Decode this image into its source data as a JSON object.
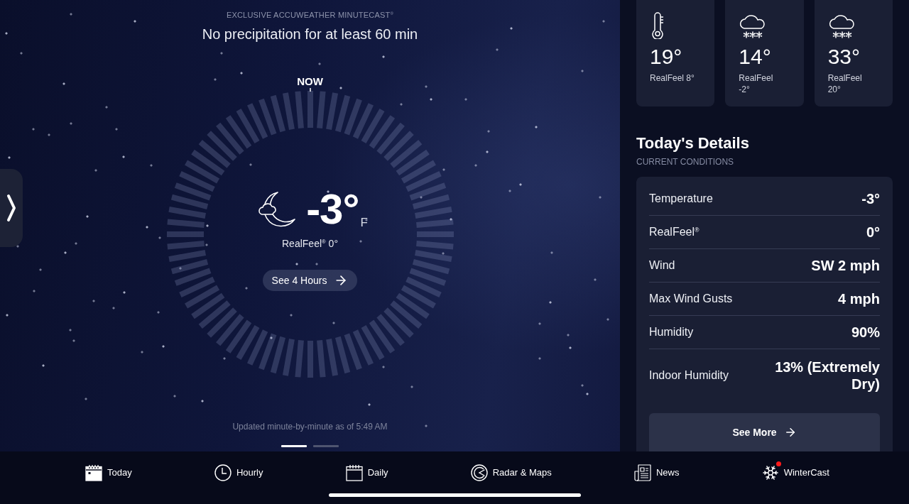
{
  "minutecast": {
    "label": "EXCLUSIVE ACCUWEATHER MINUTECAST$^{®}$",
    "headline": "No precipitation for at least 60 min",
    "now_label": "NOW",
    "temperature": "-3°",
    "unit": "F",
    "realfeel": "RealFeel$^{®}$ 0°",
    "button": "See 4 Hours",
    "updated": "Updated minute-by-minute as of 5:49 AM",
    "pages": [
      {
        "selected": true
      },
      {
        "selected": false
      }
    ]
  },
  "forecast_cards": [
    {
      "kind": "thermometer",
      "temperature": "19°",
      "realfeel": "RealFeel 8°"
    },
    {
      "kind": "snow",
      "temperature": "14°",
      "realfeel": "RealFeel -2°"
    },
    {
      "kind": "snow",
      "temperature": "33°",
      "realfeel": "RealFeel 20°"
    }
  ],
  "details": {
    "title": "Today's Details",
    "subtitle": "CURRENT CONDITIONS",
    "rows": [
      {
        "label": "Temperature",
        "value": "-3°"
      },
      {
        "label": "RealFeel$^{®}$",
        "value": "0°"
      },
      {
        "label": "Wind",
        "value": "SW 2 mph"
      },
      {
        "label": "Max Wind Gusts",
        "value": "4 mph"
      },
      {
        "label": "Humidity",
        "value": "90%"
      },
      {
        "label": "Indoor Humidity",
        "value": "13% (Extremely Dry)"
      }
    ],
    "button": "See More"
  },
  "tabs": [
    {
      "kind": "calendar",
      "label": "Today",
      "selected": true,
      "alert": false
    },
    {
      "kind": "clock",
      "label": "Hourly",
      "selected": false,
      "alert": false
    },
    {
      "kind": "calendar",
      "label": "Daily",
      "selected": false,
      "alert": false
    },
    {
      "kind": "radar",
      "label": "Radar & Maps",
      "selected": false,
      "alert": false
    },
    {
      "kind": "news",
      "label": "News",
      "selected": false,
      "alert": false
    },
    {
      "kind": "snowflake",
      "label": "WinterCast",
      "selected": false,
      "alert": true
    }
  ]
}
